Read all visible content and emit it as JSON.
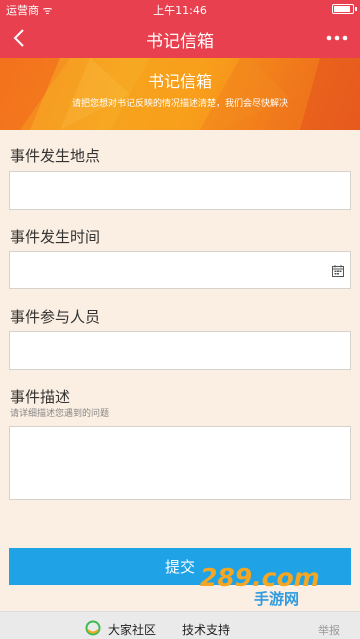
{
  "status_bar": {
    "carrier": "运营商 ᯤ",
    "time": "上午11:46"
  },
  "nav": {
    "title": "书记信箱",
    "more": "•••"
  },
  "banner": {
    "title": "书记信箱",
    "subtitle": "请把您想对书记反映的情况描述清楚，我们会尽快解决"
  },
  "form": {
    "location_label": "事件发生地点",
    "location_value": "",
    "time_label": "事件发生时间",
    "time_value": "",
    "people_label": "事件参与人员",
    "people_value": "",
    "desc_label": "事件描述",
    "desc_hint": "请详细描述您遇到的问题",
    "desc_value": "",
    "submit_label": "提交"
  },
  "watermark": {
    "text": "289.com",
    "sub": "手游网"
  },
  "footer": {
    "community": "大家社区",
    "support": "技术支持",
    "report": "举报"
  },
  "colors": {
    "nav": "#e8404e",
    "submit": "#1fa3e6",
    "page_bg": "#fbeee2"
  },
  "icons": {
    "back": "chevron-left",
    "more": "ellipsis",
    "calendar": "calendar"
  }
}
